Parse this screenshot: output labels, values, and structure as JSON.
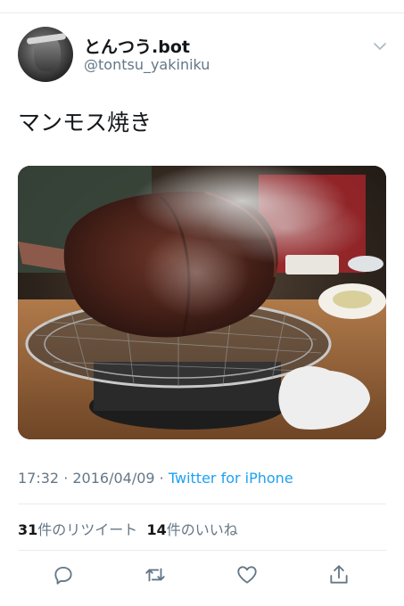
{
  "user": {
    "display_name": "とんつう.bot",
    "handle": "@tontsu_yakiniku"
  },
  "tweet": {
    "text": "マンモス焼き"
  },
  "meta": {
    "time": "17:32",
    "separator1": " · ",
    "date": "2016/04/09",
    "separator2": " · ",
    "source": "Twitter for iPhone"
  },
  "stats": {
    "retweets_count": "31",
    "retweets_label": "件のリツイート",
    "likes_count": "14",
    "likes_label": "件のいいね"
  },
  "icons": {
    "menu": "chevron-down-icon",
    "reply": "reply-icon",
    "retweet": "retweet-icon",
    "like": "heart-icon",
    "share": "share-icon"
  },
  "colors": {
    "link": "#1da1f2",
    "secondary_text": "#657786",
    "icon": "#657786",
    "divider": "#e6ecf0"
  }
}
